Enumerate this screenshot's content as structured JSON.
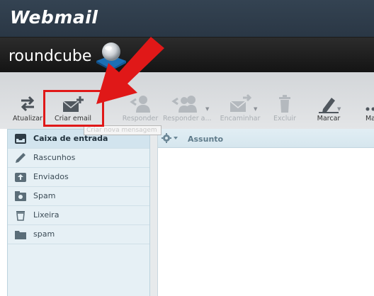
{
  "brand": {
    "webmail": "Webmail",
    "roundcube": "roundcube"
  },
  "toolbar": {
    "buttons": [
      {
        "label": "Atualizar",
        "icon": "refresh-icon",
        "enabled": true
      },
      {
        "label": "Criar email",
        "icon": "compose-icon",
        "enabled": true
      },
      {
        "label": "Responder",
        "icon": "reply-icon",
        "enabled": false
      },
      {
        "label": "Responder a...",
        "icon": "reply-all-icon",
        "enabled": false
      },
      {
        "label": "Encaminhar",
        "icon": "forward-icon",
        "enabled": false
      },
      {
        "label": "Excluir",
        "icon": "trash-icon",
        "enabled": false
      },
      {
        "label": "Marcar",
        "icon": "mark-icon",
        "enabled": true
      },
      {
        "label": "Ma",
        "icon": "more-icon",
        "enabled": true
      }
    ],
    "tooltip": "Criar nova mensagem"
  },
  "folders": [
    {
      "name": "Caixa de entrada",
      "icon": "inbox-icon",
      "selected": true
    },
    {
      "name": "Rascunhos",
      "icon": "pencil-icon",
      "selected": false
    },
    {
      "name": "Enviados",
      "icon": "sent-icon",
      "selected": false
    },
    {
      "name": "Spam",
      "icon": "spam-icon",
      "selected": false
    },
    {
      "name": "Lixeira",
      "icon": "trash-icon",
      "selected": false
    },
    {
      "name": "spam",
      "icon": "folder-icon",
      "selected": false
    }
  ],
  "message_list": {
    "column_subject": "Assunto"
  },
  "colors": {
    "annotation": "#e01818",
    "header_dark": "#2a3745"
  }
}
